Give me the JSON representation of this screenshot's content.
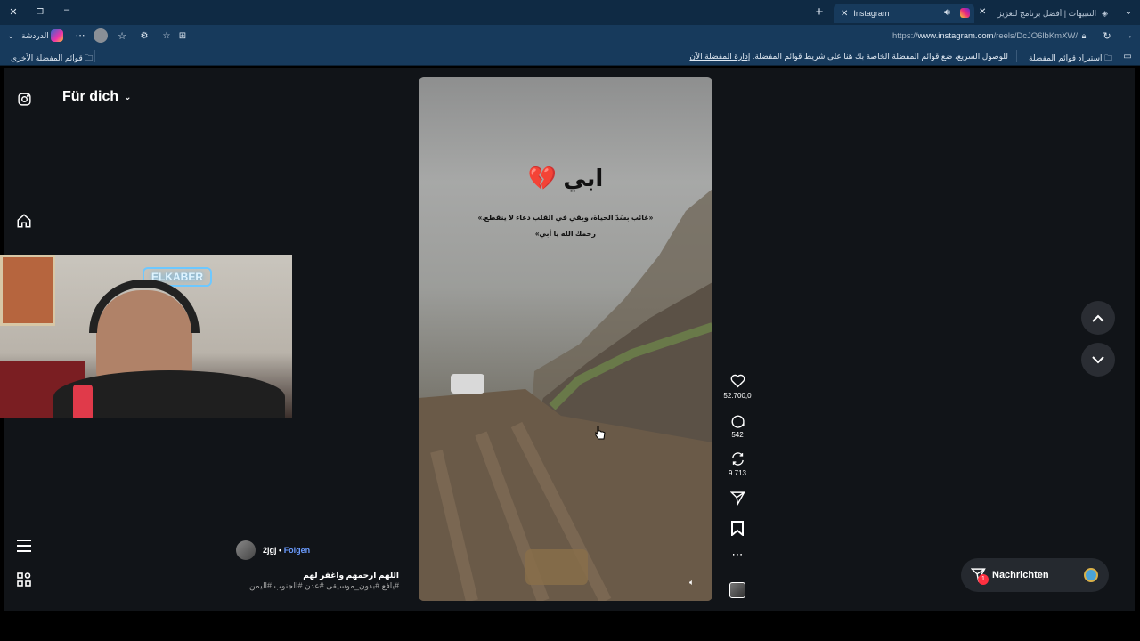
{
  "browser": {
    "tabs": [
      {
        "label": "Instagram",
        "active": true
      },
      {
        "label": "التنبيهات | أفضل برنامج لتعزيز البث",
        "active": false
      }
    ],
    "url_prefix": "https://",
    "url_domain": "www.instagram.com",
    "url_path": "/reels/DcJO6lbKmXW/",
    "chat_label": "الدردشة",
    "favorites": {
      "other_favorites": "قوائم المفضلة الأخرى",
      "message": "للوصول السريع، ضع قوائم المفضلة الخاصة بك هنا على شريط قوائم المفضلة.",
      "manage_link": "إدارة المفضلة الآن",
      "import": "استيراد قوائم المفضلة"
    }
  },
  "instagram": {
    "feed_title": "Für dich",
    "post": {
      "username": "2jgj",
      "follow_label": "Folgen",
      "caption": "اللهم ارحمهم واغفر لهم",
      "hashtags": "#يافع #بدون_موسيقى #عدن #الجنوب #اليمن",
      "overlay_title": "ابي",
      "overlay_emoji": "💔",
      "overlay_line1": "«غائب بسَدّ الحياة، وبقي في القلب دعاء لا ينقطع.»",
      "overlay_line2": "رحمك الله يا أبي»"
    },
    "actions": {
      "likes": "52.700,0",
      "comments": "542",
      "reposts": "9.713"
    },
    "messages_label": "Nachrichten",
    "messages_badge": "1"
  },
  "webcam": {
    "neon_sign": "ELKABER"
  },
  "colors": {
    "accent_link": "#6b9cff",
    "badge_red": "#ff3040",
    "chrome_dark": "#0f2a44",
    "chrome_mid": "#173a5c"
  }
}
